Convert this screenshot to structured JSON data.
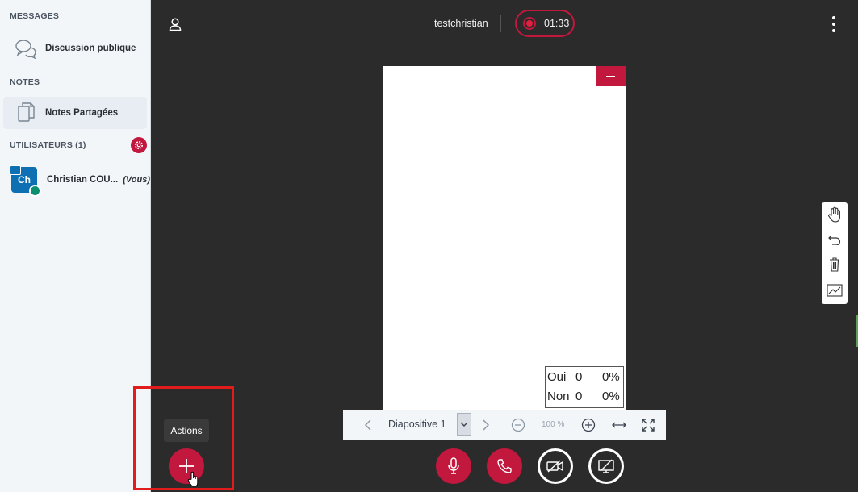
{
  "sidebar": {
    "messages_title": "MESSAGES",
    "public_chat_label": "Discussion publique",
    "notes_title": "NOTES",
    "shared_notes_label": "Notes Partagées",
    "users_title": "UTILISATEURS (1)",
    "user": {
      "initials": "Ch",
      "name": "Christian COU...",
      "you_label": "(Vous)"
    }
  },
  "header": {
    "meeting_title": "testchristian",
    "recording_time": "01:33"
  },
  "presentation": {
    "poll_results": [
      {
        "option": "Oui",
        "votes": "0",
        "percent": "0%"
      },
      {
        "option": "Non",
        "votes": "0",
        "percent": "0%"
      }
    ],
    "slide_label": "Diapositive 1",
    "zoom_value": "100 %"
  },
  "actions": {
    "tooltip": "Actions"
  },
  "colors": {
    "accent": "#c2183d",
    "background": "#2b2b2b",
    "sidebar": "#f3f6f9"
  }
}
